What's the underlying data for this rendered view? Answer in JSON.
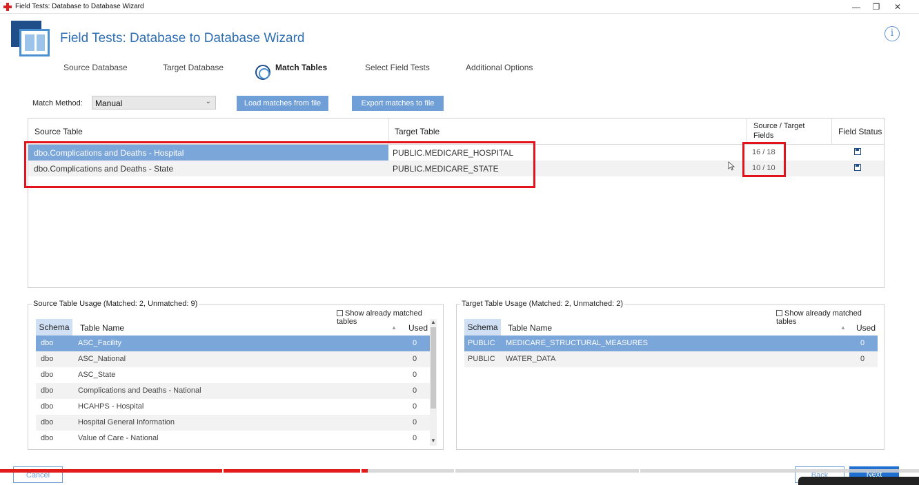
{
  "window": {
    "title": "Field Tests: Database to Database Wizard",
    "controls": {
      "minimize": "—",
      "maximize": "❐",
      "close": "✕"
    }
  },
  "header": {
    "title": "Field Tests: Database to Database Wizard",
    "info_icon": "i"
  },
  "steps": [
    {
      "label": "Source Database",
      "active": false
    },
    {
      "label": "Target Database",
      "active": false
    },
    {
      "label": "Match Tables",
      "active": true
    },
    {
      "label": "Select Field Tests",
      "active": false
    },
    {
      "label": "Additional Options",
      "active": false
    }
  ],
  "match_method": {
    "label": "Match Method:",
    "value": "Manual",
    "load_button": "Load matches from file",
    "export_button": "Export matches to file"
  },
  "matches_grid": {
    "columns": {
      "source": "Source Table",
      "target": "Target Table",
      "fields_line1": "Source / Target",
      "fields_line2": "Fields",
      "status": "Field Status"
    },
    "rows": [
      {
        "source": "dbo.Complications and Deaths - Hospital",
        "target": "PUBLIC.MEDICARE_HOSPITAL",
        "fields": "16 / 18",
        "status_icon": "save-disk-icon"
      },
      {
        "source": "dbo.Complications and Deaths - State",
        "target": "PUBLIC.MEDICARE_STATE",
        "fields": "10 / 10",
        "status_icon": "save-disk-icon"
      }
    ]
  },
  "source_usage": {
    "legend": "Source Table Usage (Matched: 2, Unmatched: 9)",
    "show_matched": "Show already matched tables",
    "columns": {
      "schema": "Schema",
      "name": "Table Name",
      "used": "Used"
    },
    "rows": [
      {
        "schema": "dbo",
        "name": "ASC_Facility",
        "used": "0"
      },
      {
        "schema": "dbo",
        "name": "ASC_National",
        "used": "0"
      },
      {
        "schema": "dbo",
        "name": "ASC_State",
        "used": "0"
      },
      {
        "schema": "dbo",
        "name": "Complications and Deaths - National",
        "used": "0"
      },
      {
        "schema": "dbo",
        "name": "HCAHPS - Hospital",
        "used": "0"
      },
      {
        "schema": "dbo",
        "name": "Hospital General Information",
        "used": "0"
      },
      {
        "schema": "dbo",
        "name": "Value of Care - National",
        "used": "0"
      }
    ]
  },
  "target_usage": {
    "legend": "Target Table Usage (Matched: 2, Unmatched: 2)",
    "show_matched": "Show already matched tables",
    "columns": {
      "schema": "Schema",
      "name": "Table Name",
      "used": "Used"
    },
    "rows": [
      {
        "schema": "PUBLIC",
        "name": "MEDICARE_STRUCTURAL_MEASURES",
        "used": "0"
      },
      {
        "schema": "PUBLIC",
        "name": "WATER_DATA",
        "used": "0"
      }
    ]
  },
  "footer": {
    "cancel": "Cancel",
    "back": "Back",
    "next": "Next"
  },
  "video_progress": 0.4,
  "colors": {
    "accent": "#2e6fb3",
    "selected_row": "#7aa6d9",
    "highlight": "#e3131b",
    "button": "#6f9fd6"
  }
}
